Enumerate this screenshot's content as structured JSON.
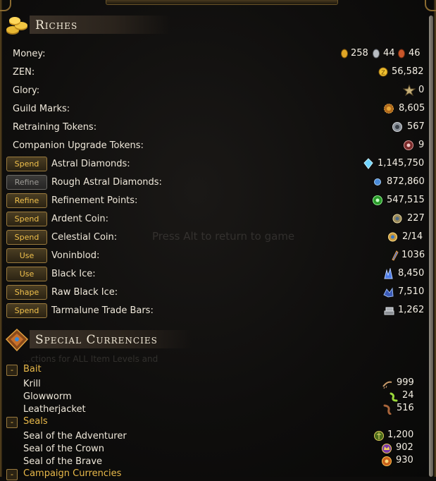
{
  "riches": {
    "title": "Riches",
    "money_label": "Money:",
    "money": {
      "gold": "258",
      "silver": "44",
      "copper": "46"
    },
    "rows": [
      {
        "label": "ZEN:",
        "value": "56,582",
        "icon": "zen-coin-icon"
      },
      {
        "label": "Glory:",
        "value": "0",
        "icon": "glory-icon"
      },
      {
        "label": "Guild Marks:",
        "value": "8,605",
        "icon": "guild-mark-icon"
      },
      {
        "label": "Retraining Tokens:",
        "value": "567",
        "icon": "retraining-token-icon"
      },
      {
        "label": "Companion Upgrade Tokens:",
        "value": "9",
        "icon": "companion-token-icon"
      }
    ],
    "action_rows": [
      {
        "button": "Spend",
        "label": "Astral Diamonds:",
        "value": "1,145,750",
        "icon": "astral-diamond-icon",
        "enabled": true
      },
      {
        "button": "Refine",
        "label": "Rough Astral Diamonds:",
        "value": "872,860",
        "icon": "rough-astral-diamond-icon",
        "enabled": false
      },
      {
        "button": "Refine",
        "label": "Refinement Points:",
        "value": "547,515",
        "icon": "refinement-points-icon",
        "enabled": true
      },
      {
        "button": "Spend",
        "label": "Ardent Coin:",
        "value": "227",
        "icon": "ardent-coin-icon",
        "enabled": true
      },
      {
        "button": "Spend",
        "label": "Celestial Coin:",
        "value": "2/14",
        "icon": "celestial-coin-icon",
        "enabled": true
      },
      {
        "button": "Use",
        "label": "Voninblod:",
        "value": "1036",
        "icon": "voninblod-icon",
        "enabled": true
      },
      {
        "button": "Use",
        "label": "Black Ice:",
        "value": "8,450",
        "icon": "black-ice-icon",
        "enabled": true
      },
      {
        "button": "Shape",
        "label": "Raw Black Ice:",
        "value": "7,510",
        "icon": "raw-black-ice-icon",
        "enabled": true
      },
      {
        "button": "Spend",
        "label": "Tarmalune Trade Bars:",
        "value": "1,262",
        "icon": "trade-bar-icon",
        "enabled": true
      }
    ]
  },
  "overlay_text": "Press Alt to return to game",
  "ghost_text": "...ctions for ALL Item Levels  and",
  "special": {
    "title": "Special Currencies",
    "bait": {
      "label": "Bait",
      "items": [
        {
          "label": "Krill",
          "value": "999",
          "icon": "krill-icon"
        },
        {
          "label": "Glowworm",
          "value": "24",
          "icon": "glowworm-icon"
        },
        {
          "label": "Leatherjacket",
          "value": "516",
          "icon": "leatherjacket-icon"
        }
      ]
    },
    "seals": {
      "label": "Seals",
      "items": [
        {
          "label": "Seal of the Adventurer",
          "value": "1,200",
          "icon": "seal-adventurer-icon"
        },
        {
          "label": "Seal of the Crown",
          "value": "902",
          "icon": "seal-crown-icon"
        },
        {
          "label": "Seal of the Brave",
          "value": "930",
          "icon": "seal-brave-icon"
        }
      ]
    },
    "campaign": {
      "label": "Campaign Currencies"
    }
  },
  "colors": {
    "accent": "#f0c04c",
    "category": "#e9b94a",
    "text": "#efe8da"
  }
}
